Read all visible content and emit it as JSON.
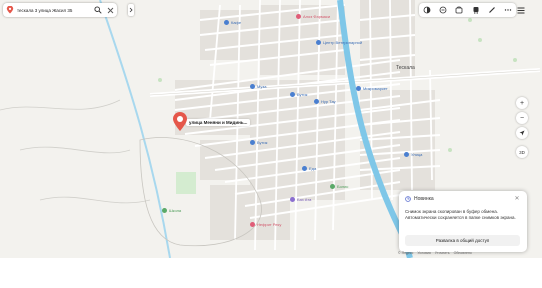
{
  "search": {
    "query": "тескала 3 улица Жасил 35",
    "icons": [
      "yandex-maps-logo",
      "search-icon",
      "close-icon"
    ]
  },
  "town_label": "Тескала",
  "pois": {
    "p1": "Алоэ Фармаси",
    "p2": "Центр Ветеринарной",
    "p3": "Муза",
    "p4": "Бутик",
    "p5": "Нур Тау",
    "p6": "Микромаркет",
    "p7": "Бутик",
    "p8": "Улица",
    "p9": "Еда",
    "p10": "Болис",
    "p11": "Баз Ата",
    "p12": "Нефрит Реку",
    "p13": "Школа",
    "p14": "Кафе"
  },
  "marker": {
    "label": "улица Меняни и Мидинь..."
  },
  "toolbar": {
    "icons": [
      "layers-icon",
      "traffic-icon",
      "panorama-icon",
      "transport-icon",
      "ruler-icon",
      "more-icon",
      "menu-icon"
    ]
  },
  "controls": {
    "zoom_in": "+",
    "zoom_out": "−",
    "compass": "➤",
    "mode_3d": "3D"
  },
  "toast": {
    "title": "Новинка",
    "body": "Снимок экрана скопирован в буфер обмена. Автоматически сохраняется в папке снимков экрана.",
    "button": "Развалка в общий доступ"
  },
  "scale": {
    "items": [
      "© Яндекс",
      "Условия",
      "Уточнить",
      "Обновлено"
    ]
  },
  "colors": {
    "river": "#7fc7e8",
    "road": "#ffffff",
    "building": "#e4e1dc",
    "marker": "#e5574a",
    "background": "#f3f2ee"
  }
}
